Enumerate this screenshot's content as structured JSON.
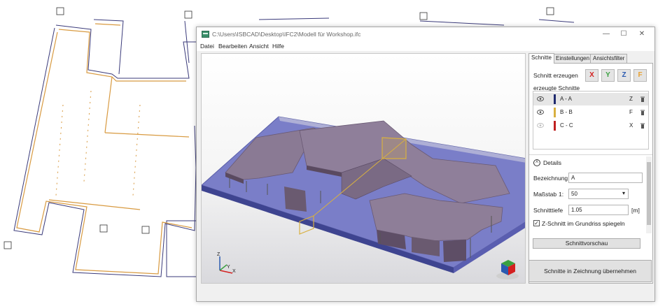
{
  "window": {
    "title": "C:\\Users\\ISBCAD\\Desktop\\IFC2\\Modell für Workshop.ifc",
    "minimize": "—",
    "maximize": "☐",
    "close": "✕"
  },
  "menu": [
    "Datei",
    "Bearbeiten",
    "Ansicht",
    "Hilfe"
  ],
  "tabs": [
    {
      "label": "Schnitte",
      "active": true
    },
    {
      "label": "Einstellungen",
      "active": false
    },
    {
      "label": "Ansichtsfilter",
      "active": false
    }
  ],
  "schnitt_erzeugen": {
    "label": "Schnitt erzeugen",
    "buttons": [
      {
        "label": "X",
        "color": "#d42020"
      },
      {
        "label": "Y",
        "color": "#3aa040"
      },
      {
        "label": "Z",
        "color": "#2a5ab0"
      },
      {
        "label": "F",
        "color": "#e8a030"
      }
    ]
  },
  "erzeugte_schnitte": {
    "label": "erzeugte Schnitte",
    "items": [
      {
        "name": "A - A",
        "axis": "Z",
        "color": "#1f2a6e",
        "visible": true,
        "selected": true
      },
      {
        "name": "B - B",
        "axis": "F",
        "color": "#d8b040",
        "visible": true,
        "selected": false
      },
      {
        "name": "C - C",
        "axis": "X",
        "color": "#c02020",
        "visible": false,
        "selected": false
      }
    ]
  },
  "details": {
    "header": "Details",
    "collapse_glyph": "˄",
    "bezeichnung_label": "Bezeichnung",
    "bezeichnung_value": "A",
    "massstab_label": "Maßstab",
    "massstab_prefix": "1:",
    "massstab_value": "50",
    "dropdown_glyph": "▾",
    "schnitttiefe_label": "Schnitttiefe",
    "schnitttiefe_value": "1.05",
    "schnitttiefe_unit": "[m]",
    "checkbox_label": "Z-Schnitt im Grundriss spiegeln",
    "checkbox_checked": true,
    "checkbox_glyph": "✓"
  },
  "buttons": {
    "preview": "Schnittvorschau",
    "apply": "Schnitte in Zeichnung übernehmen"
  },
  "axes": {
    "z": "Z",
    "y": "Y",
    "x": "X"
  }
}
